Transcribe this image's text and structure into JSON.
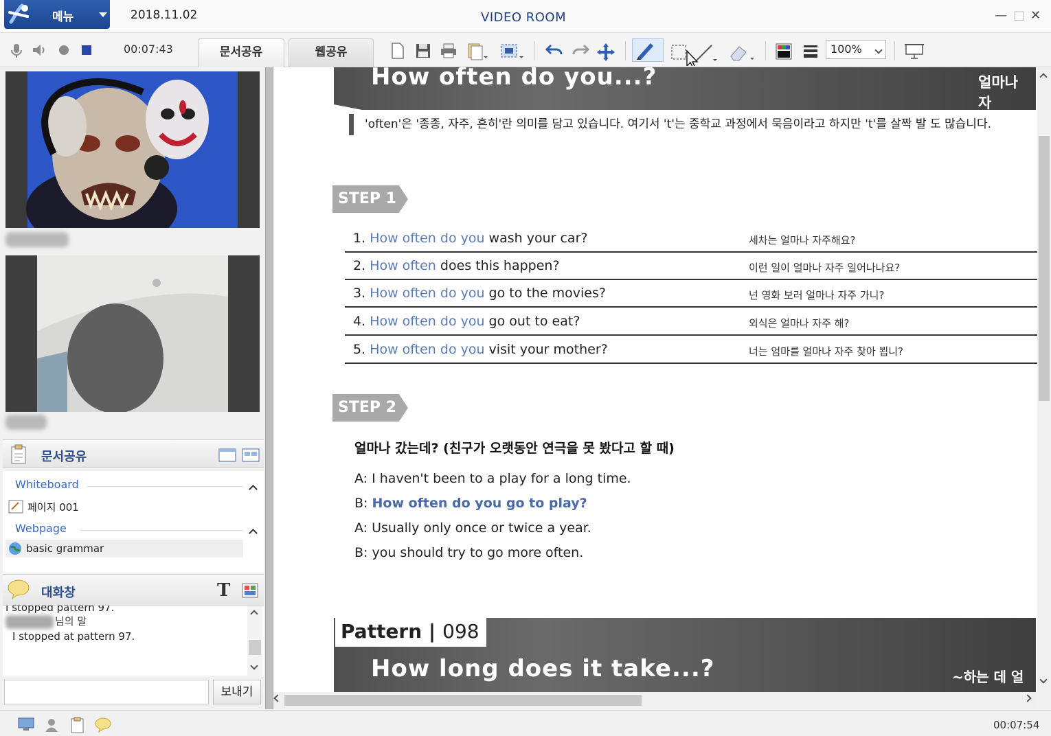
{
  "titlebar": {
    "menu_label": "메뉴",
    "date": "2018.11.02",
    "app_title": "VIDEO ROOM"
  },
  "toolbar": {
    "timer": "00:07:43",
    "tabs": [
      {
        "label": "문서공유",
        "active": true
      },
      {
        "label": "웹공유",
        "active": false
      }
    ],
    "zoom": "100%"
  },
  "left_panel": {
    "documents": {
      "title": "문서공유",
      "groups": [
        {
          "label": "Whiteboard",
          "items": [
            "페이지 001"
          ]
        },
        {
          "label": "Webpage",
          "items": [
            "basic grammar"
          ]
        }
      ]
    },
    "chat": {
      "title": "대화창",
      "lines": [
        "I stopped pattern 97.",
        "님의 말",
        "I stopped at pattern 97."
      ],
      "send_label": "보내기"
    }
  },
  "document": {
    "banner_title": "How often do you...?",
    "banner_ko": "얼마나 자",
    "note": "'often'은 '종종, 자주, 흔히'란 의미를 담고 있습니다. 여기서 't'는 중학교 과정에서 묵음이라고 하지만 't'를 살짝 발 도 많습니다.",
    "step1_label": "STEP 1",
    "step1_rows": [
      {
        "num": "1.",
        "hl": "How often do you",
        "rest": " wash your car?",
        "ko": "세차는 얼마나 자주해요?"
      },
      {
        "num": "2.",
        "hl": "How often",
        "rest": " does this happen?",
        "ko": "이런 일이 얼마나 자주 일어나나요?"
      },
      {
        "num": "3.",
        "hl": "How often do you",
        "rest": " go to the movies?",
        "ko": "넌 영화 보러 얼마나 자주 가니?"
      },
      {
        "num": "4.",
        "hl": "How often do you",
        "rest": " go out to eat?",
        "ko": "외식은 얼마나 자주 해?"
      },
      {
        "num": "5.",
        "hl": "How often do you",
        "rest": " visit your mother?",
        "ko": "너는 엄마를 얼마나 자주 찾아 뵙니?"
      }
    ],
    "step2_label": "STEP 2",
    "dialogue_title": "얼마나 갔는데? (친구가 오랫동안 연극을 못 봤다고 할 때)",
    "dialogue": [
      {
        "speaker": "A:",
        "text": "I haven't been to a play for a long time.",
        "strong": false
      },
      {
        "speaker": "B:",
        "text": "How often do you go to play?",
        "strong": true
      },
      {
        "speaker": "A:",
        "text": "Usually only once or twice a year.",
        "strong": false
      },
      {
        "speaker": "B:",
        "text": "you should try to go more often.",
        "strong": false
      }
    ],
    "pattern_label": "Pattern",
    "pattern_num": "098",
    "next_title": "How long does it take...?",
    "next_ko": "~하는 데 얼"
  },
  "status": {
    "time": "00:07:54"
  }
}
